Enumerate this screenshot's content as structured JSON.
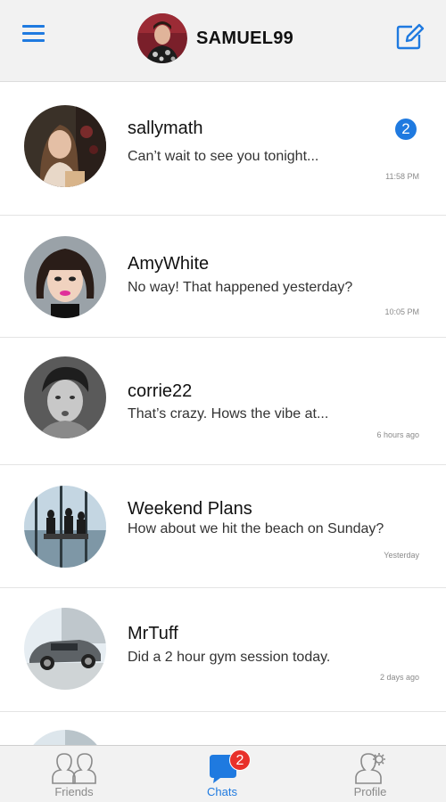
{
  "header": {
    "username": "SAMUEL99",
    "menu_icon": "hamburger-menu-icon",
    "compose_icon": "compose-edit-icon",
    "accent_color": "#1f7ae0"
  },
  "chats": [
    {
      "name": "sallymath",
      "preview": "Can’t wait to see you tonight...",
      "time": "11:58 PM",
      "unread": "2"
    },
    {
      "name": "AmyWhite",
      "preview": "No way! That happened yesterday?",
      "time": "10:05 PM"
    },
    {
      "name": "corrie22",
      "preview": "That’s crazy. Hows the vibe at...",
      "time": "6 hours ago"
    },
    {
      "name": "Weekend Plans",
      "preview": "How about we hit the beach on Sunday?",
      "time": "Yesterday"
    },
    {
      "name": "MrTuff",
      "preview": "Did a 2 hour gym session today.",
      "time": "2 days ago"
    }
  ],
  "tabs": [
    {
      "label": "Friends",
      "icon": "friends-icon"
    },
    {
      "label": "Chats",
      "icon": "chat-bubble-icon",
      "badge": "2",
      "active": true
    },
    {
      "label": "Profile",
      "icon": "profile-settings-icon"
    }
  ],
  "colors": {
    "badge_blue": "#1f7ae0",
    "badge_red": "#e8302a"
  }
}
